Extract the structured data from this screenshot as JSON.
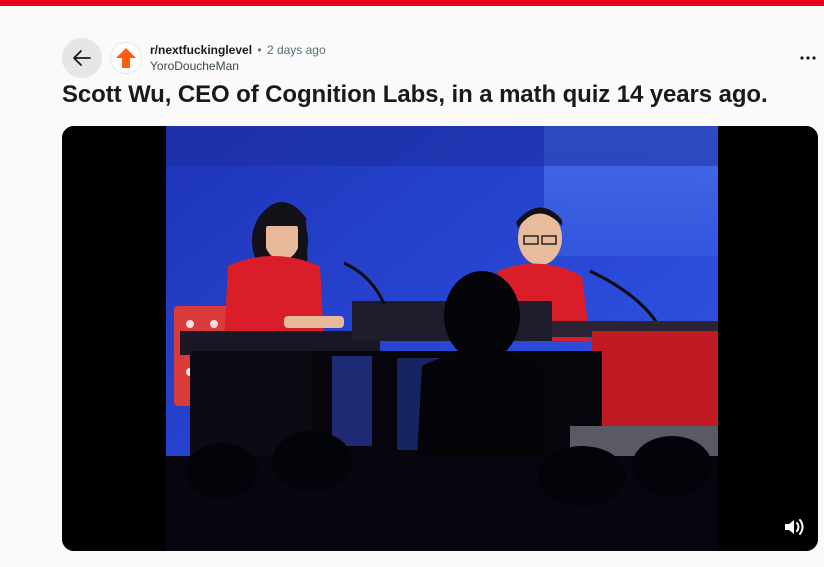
{
  "post": {
    "subreddit": "r/nextfuckinglevel",
    "separator": "•",
    "time_ago": "2 days ago",
    "author": "YoroDoucheMan",
    "title": "Scott Wu, CEO of Cognition Labs, in a math quiz 14 years ago."
  },
  "icons": {
    "back": "arrow-left-icon",
    "subreddit_avatar": "upvote-arrow-icon",
    "more": "ellipsis-icon",
    "volume": "volume-icon"
  },
  "colors": {
    "accent": "#e8001c",
    "subreddit_icon": "#ff5c12",
    "stage_background": "#2141d6"
  }
}
